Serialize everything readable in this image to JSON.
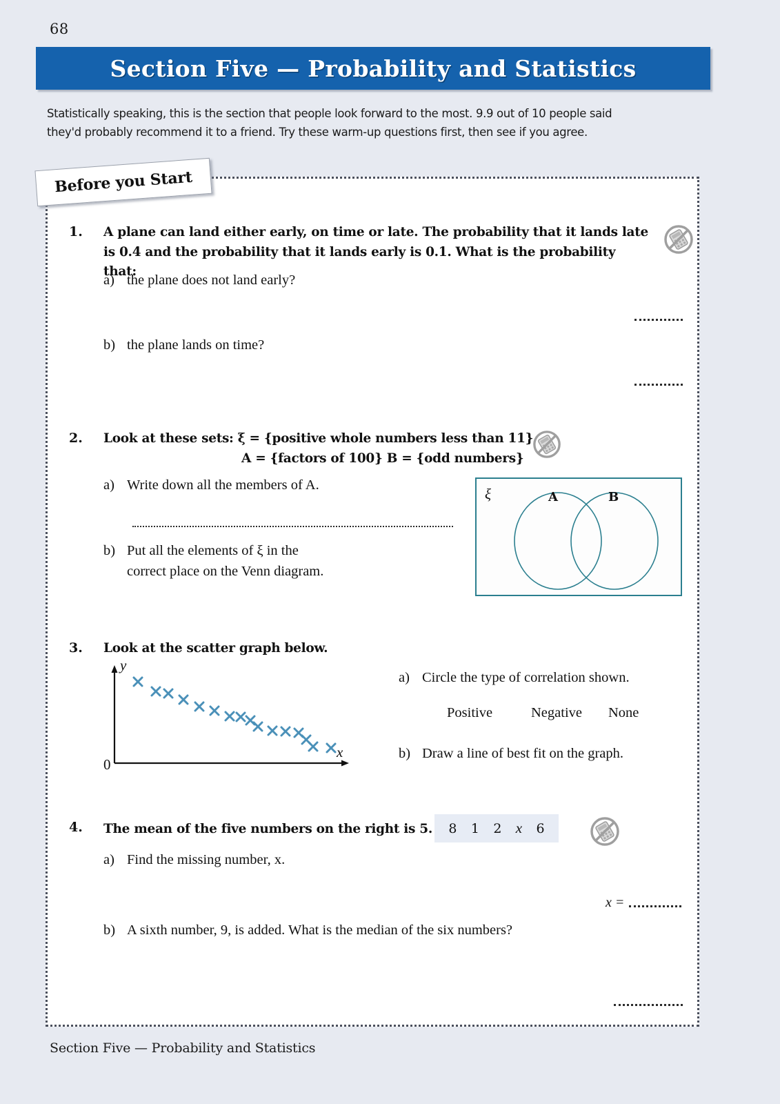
{
  "page": {
    "number": "68",
    "background_color": "#e7eaf1",
    "banner_color": "#1562ad"
  },
  "banner": {
    "title": "Section Five — Probability and Statistics"
  },
  "intro": {
    "line1": "Statistically speaking, this is the section that people look forward to the most.  9.9 out of 10 people said",
    "line2": "they'd probably recommend it to a friend.  Try these warm-up questions first, then see if you agree."
  },
  "tab": {
    "label": "Before you Start"
  },
  "questions": [
    {
      "number": "1.",
      "stem_line1": "A plane can land either early, on time or late.  The probability that it lands late",
      "stem_line2": "is 0.4 and the probability that it lands early is 0.1.  What is the probability that:",
      "icon": "no-calculator-icon",
      "parts": [
        {
          "label": "a)",
          "text": "the plane does not land early?"
        },
        {
          "label": "b)",
          "text": "the plane lands on time?"
        }
      ]
    },
    {
      "number": "2.",
      "stem_line1": "Look at these sets:   ξ = {positive whole numbers less than 11}",
      "stem_line2": "A = {factors of 100}      B = {odd numbers}",
      "icon": "no-calculator-icon",
      "parts": [
        {
          "label": "a)",
          "text": "Write down all the members of A."
        },
        {
          "label": "b)",
          "text": "Put all the elements of ξ in the",
          "text2": "correct place on the Venn diagram."
        }
      ],
      "venn": {
        "universal_label": "ξ",
        "set_a_label": "A",
        "set_b_label": "B",
        "stroke_color": "#2b7f8f"
      }
    },
    {
      "number": "3.",
      "stem_line1": "Look at the scatter graph below.",
      "parts": [
        {
          "label": "a)",
          "text": "Circle the type of correlation shown."
        },
        {
          "label": "b)",
          "text": "Draw a line of best fit on the graph."
        }
      ],
      "options": [
        "Positive",
        "Negative",
        "None"
      ]
    },
    {
      "number": "4.",
      "stem_line1": "The mean of the five numbers on the right is 5.",
      "icon": "no-calculator-icon",
      "numbers": [
        "8",
        "1",
        "2",
        "x",
        "6"
      ],
      "parts": [
        {
          "label": "a)",
          "text": "Find the missing number, x."
        },
        {
          "label": "b)",
          "text": "A sixth number, 9, is added.  What is the median of the six numbers?"
        }
      ],
      "answer_prefix": "x ="
    }
  ],
  "chart_data": {
    "type": "scatter",
    "title": "",
    "xlabel": "x",
    "ylabel": "y",
    "origin_label": "0",
    "correlation": "negative",
    "marker": "x",
    "marker_color": "#4a90b8",
    "grid": false,
    "xlim": [
      0,
      100
    ],
    "ylim": [
      0,
      100
    ],
    "points": [
      [
        14,
        86
      ],
      [
        24,
        78
      ],
      [
        30,
        76
      ],
      [
        38,
        70
      ],
      [
        46,
        64
      ],
      [
        54,
        60
      ],
      [
        62,
        55
      ],
      [
        68,
        54
      ],
      [
        73,
        51
      ],
      [
        77,
        45
      ],
      [
        84,
        40
      ],
      [
        90,
        39
      ],
      [
        96,
        38
      ],
      [
        100,
        31
      ],
      [
        106,
        24
      ],
      [
        116,
        23
      ]
    ]
  },
  "footer": {
    "text": "Section Five — Probability and Statistics"
  }
}
